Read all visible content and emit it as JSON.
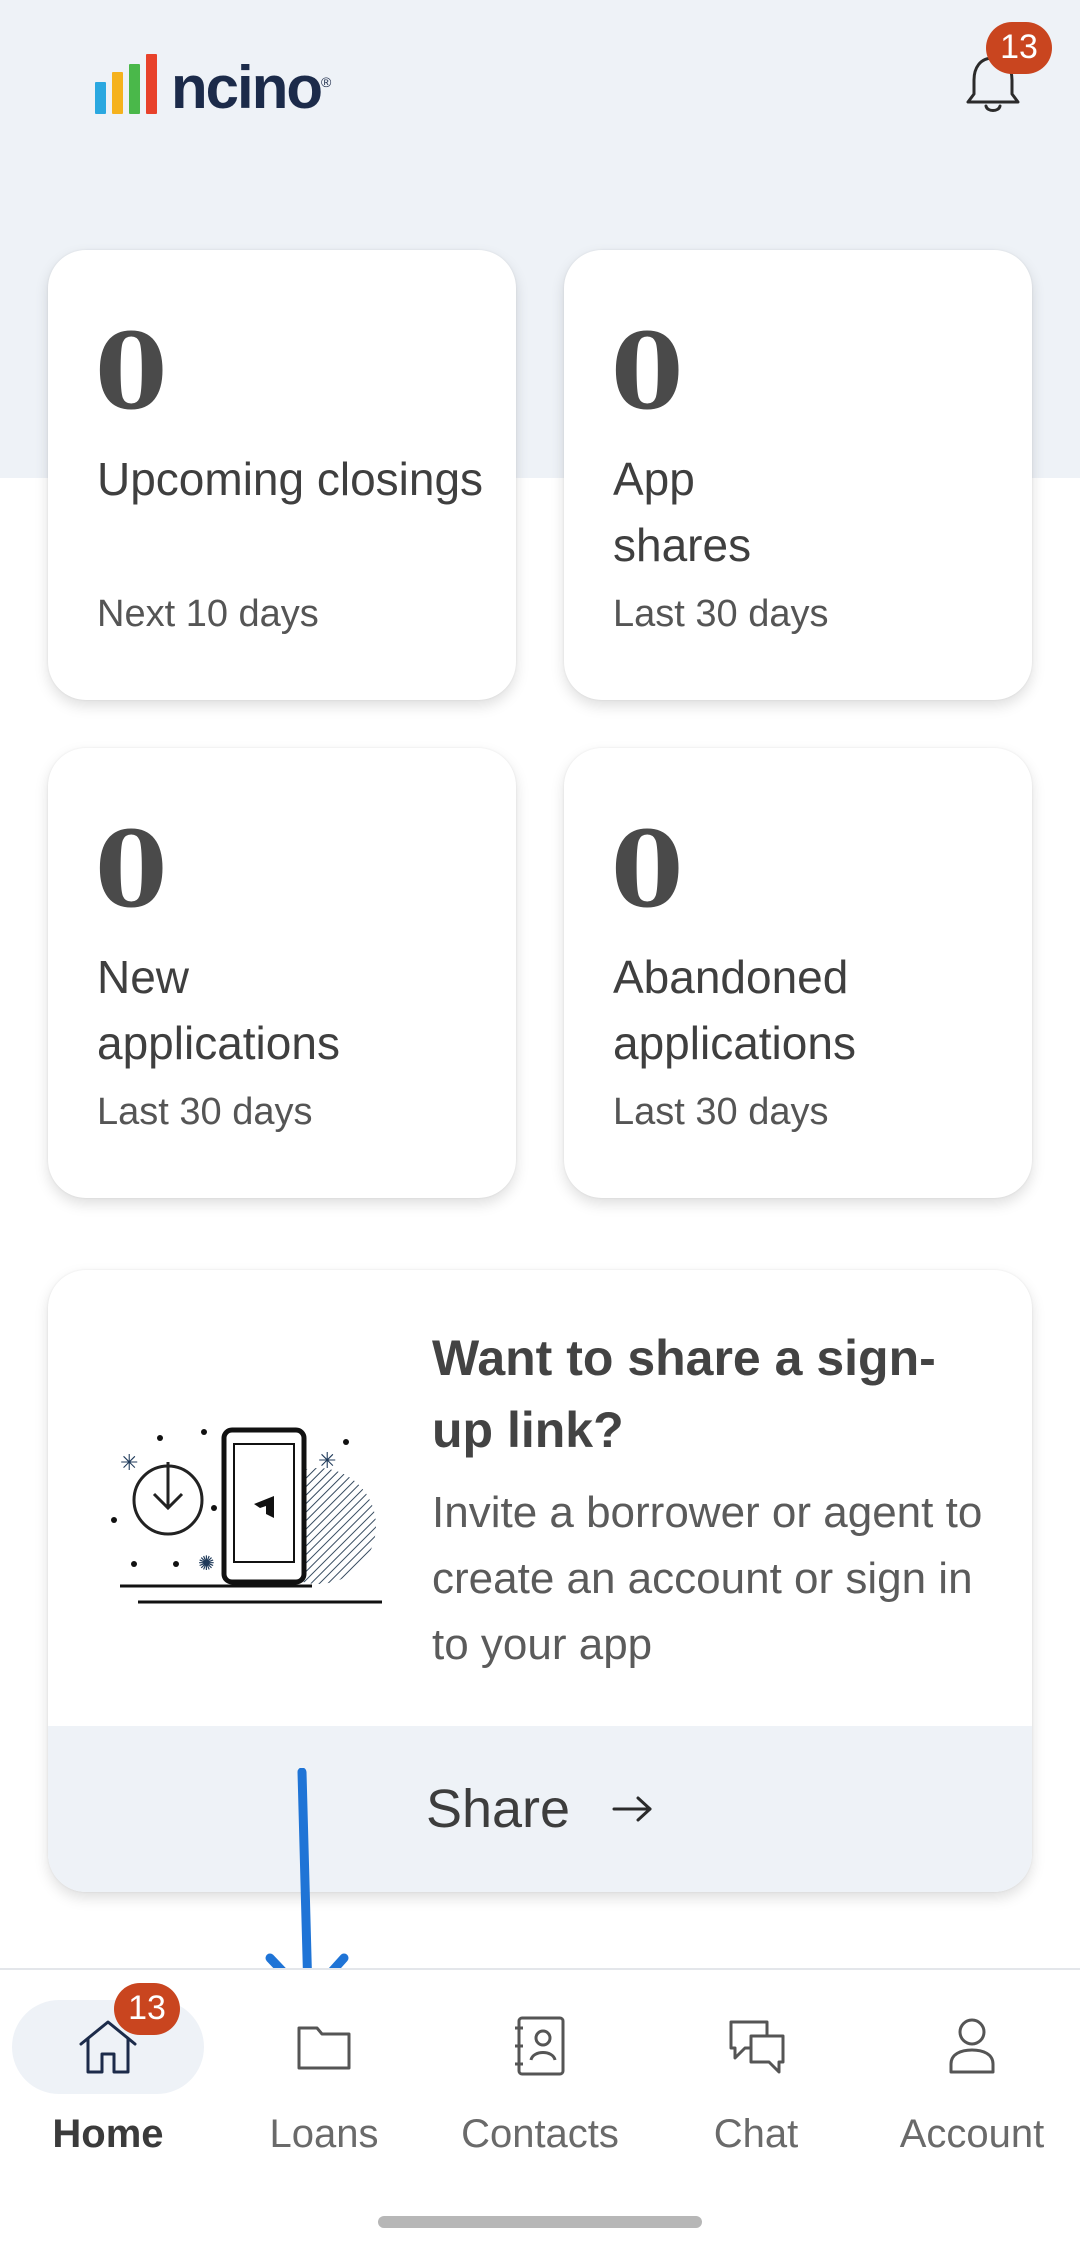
{
  "header": {
    "logo_text": "ncino",
    "logo_mark": "®",
    "logo_bar_colors": [
      "#2aa8e0",
      "#f5b21d",
      "#4ab84a",
      "#e8422b"
    ],
    "notification_badge": "13"
  },
  "stats": [
    {
      "value": "0",
      "label": "Upcoming closings",
      "sub": "Next 10 days"
    },
    {
      "value": "0",
      "label": "App shares",
      "sub": "Last 30 days"
    },
    {
      "value": "0",
      "label": "New applications",
      "sub": "Last 30 days"
    },
    {
      "value": "0",
      "label": "Abandoned applications",
      "sub": "Last 30 days"
    }
  ],
  "share_card": {
    "title": "Want to share a sign-up link?",
    "description": "Invite a borrower or agent to create an account or sign in to your app",
    "button_label": "Share",
    "button_icon": "arrow-right-icon"
  },
  "annotation": {
    "color": "#1f74d6",
    "icon": "arrow-down-icon"
  },
  "nav": {
    "items": [
      {
        "label": "Home",
        "icon": "home-icon",
        "active": true,
        "badge": "13"
      },
      {
        "label": "Loans",
        "icon": "folder-icon"
      },
      {
        "label": "Contacts",
        "icon": "contacts-book-icon"
      },
      {
        "label": "Chat",
        "icon": "chat-bubbles-icon"
      },
      {
        "label": "Account",
        "icon": "person-icon"
      }
    ]
  },
  "colors": {
    "background_band": "#eef2f7",
    "badge": "#c9451f",
    "text_dark": "#3d3d3d"
  }
}
